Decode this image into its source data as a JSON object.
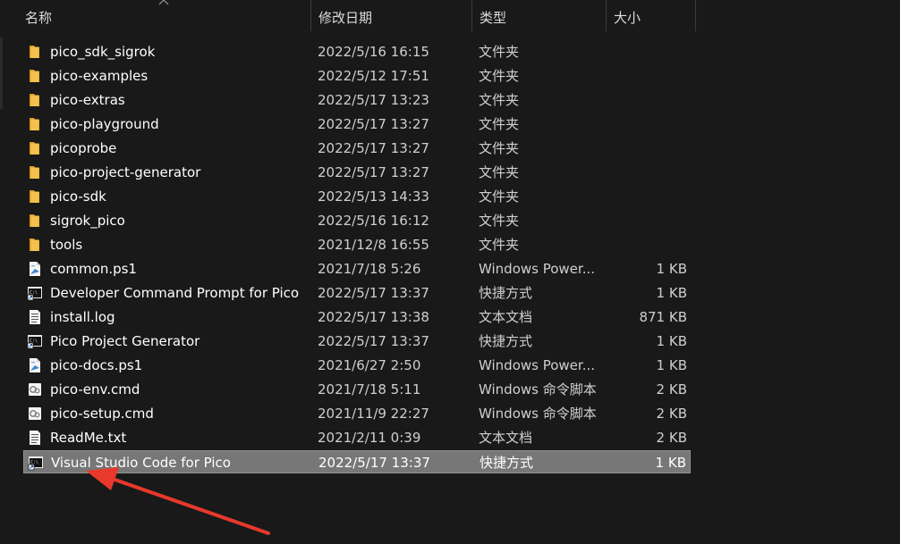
{
  "header": {
    "name": "名称",
    "modified": "修改日期",
    "type": "类型",
    "size": "大小"
  },
  "files": [
    {
      "name": "pico_sdk_sigrok",
      "date": "2022/5/16 16:15",
      "type": "文件夹",
      "size": "",
      "icon": "folder-icon"
    },
    {
      "name": "pico-examples",
      "date": "2022/5/12 17:51",
      "type": "文件夹",
      "size": "",
      "icon": "folder-icon"
    },
    {
      "name": "pico-extras",
      "date": "2022/5/17 13:23",
      "type": "文件夹",
      "size": "",
      "icon": "folder-icon"
    },
    {
      "name": "pico-playground",
      "date": "2022/5/17 13:27",
      "type": "文件夹",
      "size": "",
      "icon": "folder-icon"
    },
    {
      "name": "picoprobe",
      "date": "2022/5/17 13:27",
      "type": "文件夹",
      "size": "",
      "icon": "folder-icon"
    },
    {
      "name": "pico-project-generator",
      "date": "2022/5/17 13:27",
      "type": "文件夹",
      "size": "",
      "icon": "folder-icon"
    },
    {
      "name": "pico-sdk",
      "date": "2022/5/13 14:33",
      "type": "文件夹",
      "size": "",
      "icon": "folder-icon"
    },
    {
      "name": "sigrok_pico",
      "date": "2022/5/16 16:12",
      "type": "文件夹",
      "size": "",
      "icon": "folder-icon"
    },
    {
      "name": "tools",
      "date": "2021/12/8 16:55",
      "type": "文件夹",
      "size": "",
      "icon": "folder-icon"
    },
    {
      "name": "common.ps1",
      "date": "2021/7/18 5:26",
      "type": "Windows Power...",
      "size": "1 KB",
      "icon": "powershell-script-icon"
    },
    {
      "name": "Developer Command Prompt for Pico",
      "date": "2022/5/17 13:37",
      "type": "快捷方式",
      "size": "1 KB",
      "icon": "shortcut-icon"
    },
    {
      "name": "install.log",
      "date": "2022/5/17 13:38",
      "type": "文本文档",
      "size": "871 KB",
      "icon": "text-file-icon"
    },
    {
      "name": "Pico Project Generator",
      "date": "2022/5/17 13:37",
      "type": "快捷方式",
      "size": "1 KB",
      "icon": "shortcut-icon"
    },
    {
      "name": "pico-docs.ps1",
      "date": "2021/6/27 2:50",
      "type": "Windows Power...",
      "size": "1 KB",
      "icon": "powershell-script-icon"
    },
    {
      "name": "pico-env.cmd",
      "date": "2021/7/18 5:11",
      "type": "Windows 命令脚本",
      "size": "2 KB",
      "icon": "cmd-script-icon"
    },
    {
      "name": "pico-setup.cmd",
      "date": "2021/11/9 22:27",
      "type": "Windows 命令脚本",
      "size": "2 KB",
      "icon": "cmd-script-icon"
    },
    {
      "name": "ReadMe.txt",
      "date": "2021/2/11 0:39",
      "type": "文本文档",
      "size": "2 KB",
      "icon": "text-file-icon"
    },
    {
      "name": "Visual Studio Code for Pico",
      "date": "2022/5/17 13:37",
      "type": "快捷方式",
      "size": "1 KB",
      "icon": "shortcut-icon",
      "selected": true
    }
  ],
  "colors": {
    "background": "#191919",
    "selection": "#777777",
    "annotation_arrow": "#e8392c",
    "folder": "#f2c14e"
  }
}
